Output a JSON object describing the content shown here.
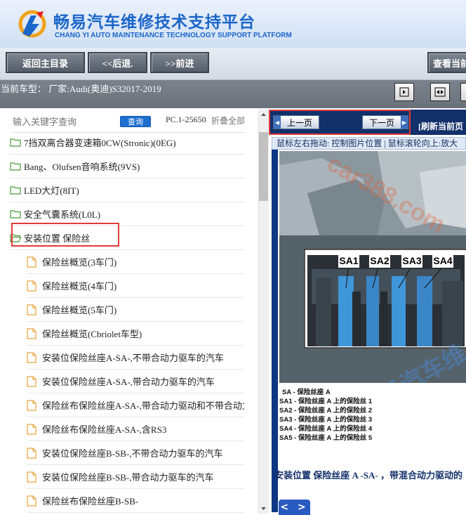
{
  "header": {
    "title": "畅易汽车维修技术支持平台",
    "subtitle": "CHANG YI AUTO MAINTENANCE TECHNOLOGY SUPPORT PLATFORM"
  },
  "toolbar": {
    "home_label": "返回主目录",
    "back_label": "<<后退.",
    "forward_label": ">>前进",
    "view_current_label": "查看当前"
  },
  "info": {
    "current_model": "当前车型：  厂家:Audi(奥迪)S32017-2019"
  },
  "search": {
    "placeholder": "输入关键字查询",
    "button_label": "查询",
    "pc_code": "PC.1-25650",
    "collapse_all": "折叠全部"
  },
  "tree": {
    "folders": [
      {
        "label": "7挡双离合器变速箱0CW(Stronic)(0EG)"
      },
      {
        "label": "Bang、Olufsen音响系统(9VS)"
      },
      {
        "label": "LED大灯(8IT)"
      },
      {
        "label": "安全气囊系统(L0L)"
      },
      {
        "label": "安装位置 保险丝"
      }
    ],
    "children": [
      {
        "label": "保险丝概览(3车门)"
      },
      {
        "label": "保险丝概览(4车门)"
      },
      {
        "label": "保险丝概览(5车门)"
      },
      {
        "label": "保险丝概览(Cbriolet车型)"
      },
      {
        "label": "安装位保险丝座A-SA-,不带合动力驱车的汽车"
      },
      {
        "label": "安装位保险丝座A-SA-,带合动力驱车的汽车"
      },
      {
        "label": "保险丝布保险丝座A-SA-,带合动力驱动和不带合动力驱"
      },
      {
        "label": "保险丝布保险丝座A-SA-,含RS3"
      },
      {
        "label": "安装位保险丝座B-SB-,不带合动力驱车的汽车"
      },
      {
        "label": "安装位保险丝座B-SB-,带合动力驱车的汽车"
      },
      {
        "label": "保险丝布保险丝座B-SB-"
      }
    ]
  },
  "viewer": {
    "prev_label": "上一页",
    "next_label": "下一页",
    "refresh_label": "[刷新当前页",
    "hint": "鼠标左右拖动: 控制图片位置 | 鼠标滚轮向上:放大",
    "slot_labels": [
      "SA1",
      "SA2",
      "SA3",
      "SA4"
    ],
    "watermark_text": "car388.com",
    "watermark_text_cn": "畅易汽车维",
    "legend": [
      "SA - 保险丝座 A",
      "SA1 - 保险丝座 A 上的保险丝 1",
      "SA2 - 保险丝座 A 上的保险丝 2",
      "SA3 - 保险丝座 A 上的保险丝 3",
      "SA4 - 保险丝座 A 上的保险丝 4",
      "SA5 - 保险丝座 A 上的保险丝 5"
    ],
    "caption": "安装位置 保险丝座 A -SA- ，带混合动力驱动的",
    "nav_arrows": "< >"
  },
  "colors": {
    "brand_blue": "#1b66c9",
    "highlight_red": "#e03b3b",
    "viewer_navy": "#12306a",
    "search_button": "#1d6fd0"
  }
}
